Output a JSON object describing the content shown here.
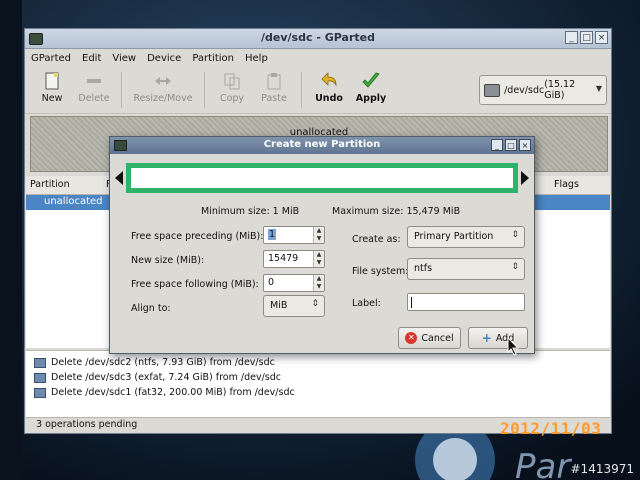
{
  "window": {
    "title": "/dev/sdc - GParted",
    "controls": [
      "_",
      "□",
      "×"
    ]
  },
  "menu": [
    "GParted",
    "Edit",
    "View",
    "Device",
    "Partition",
    "Help"
  ],
  "toolbar": {
    "new": "New",
    "delete": "Delete",
    "resize_move": "Resize/Move",
    "copy": "Copy",
    "paste": "Paste",
    "undo": "Undo",
    "apply": "Apply"
  },
  "device": {
    "path": "/dev/sdc",
    "size": "(15.12 GiB)"
  },
  "disk_graphic": {
    "label": "unallocated"
  },
  "partition_list": {
    "headers": {
      "partition": "Partition",
      "f": "F",
      "flags": "Flags"
    },
    "rows": [
      {
        "partition": "unallocated"
      }
    ]
  },
  "operations": [
    "Delete /dev/sdc2 (ntfs, 7.93 GiB) from /dev/sdc",
    "Delete /dev/sdc3 (exfat, 7.24 GiB) from /dev/sdc",
    "Delete /dev/sdc1 (fat32, 200.00 MiB) from /dev/sdc"
  ],
  "status": "3 operations pending",
  "dialog": {
    "title": "Create new Partition",
    "min_size": "Minimum size: 1 MiB",
    "max_size": "Maximum size: 15,479 MiB",
    "fields": {
      "free_preceding_label": "Free space preceding (MiB):",
      "free_preceding_value": "1",
      "new_size_label": "New size (MiB):",
      "new_size_value": "15479",
      "free_following_label": "Free space following (MiB):",
      "free_following_value": "0",
      "align_label": "Align to:",
      "align_value": "MiB",
      "create_as_label": "Create as:",
      "create_as_value": "Primary Partition",
      "filesystem_label": "File system:",
      "filesystem_value": "ntfs",
      "label_label": "Label:",
      "label_value": ""
    },
    "buttons": {
      "cancel": "Cancel",
      "add": "Add"
    },
    "colors": {
      "partition_border": "#2fb36b"
    }
  },
  "photo": {
    "date_stamp": "2012/11/03",
    "watermark": "#1413971"
  }
}
